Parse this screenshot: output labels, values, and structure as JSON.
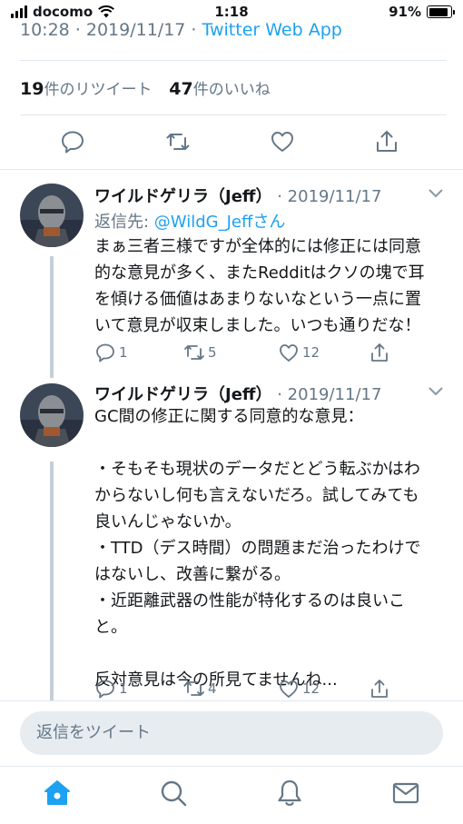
{
  "status_bar": {
    "carrier": "docomo",
    "time": "1:18",
    "battery_percent": "91%",
    "battery_level": 0.91
  },
  "tweet_meta": {
    "time_date": "10:28 · 2019/11/17 · ",
    "via": "Twitter Web App"
  },
  "stats": {
    "retweet_count": "19",
    "retweet_label": "件のリツイート",
    "like_count": "47",
    "like_label": "件のいいね"
  },
  "replies": [
    {
      "name": "ワイルドゲリラ（Jeff）",
      "date": "· 2019/11/17",
      "reply_to_label": "返信先: ",
      "reply_to_handle": "@WildG_Jeffさん",
      "text": "まぁ三者三様ですが全体的には修正には同意\n的な意見が多く、またRedditはクソの塊で耳\nを傾ける価値はあまりないなという一点に置\nいて意見が収束しました。いつも通りだな！",
      "replies": "1",
      "retweets": "5",
      "likes": "12"
    },
    {
      "name": "ワイルドゲリラ（Jeff）",
      "date": "· 2019/11/17",
      "text": "GC間の修正に関する同意的な意見：\n\n・そもそも現状のデータだとどう転ぶかはわ\nからないし何も言えないだろ。試してみても\n良いんじゃないか。\n・TTD（デス時間）の問題まだ治ったわけで\nはないし、改善に繋がる。\n・近距離武器の性能が特化するのは良いこ\nと。\n\n反対意見は今の所見てませんね...",
      "replies": "1",
      "retweets": "4",
      "likes": "12"
    }
  ],
  "compose": {
    "placeholder": "返信をツイート"
  },
  "tabs": [
    "home-icon",
    "search-icon",
    "notifications-icon",
    "messages-icon"
  ],
  "colors": {
    "accent": "#1da1f2",
    "muted": "#657786",
    "text": "#14171a",
    "compose_bg": "#e6ecf0"
  }
}
